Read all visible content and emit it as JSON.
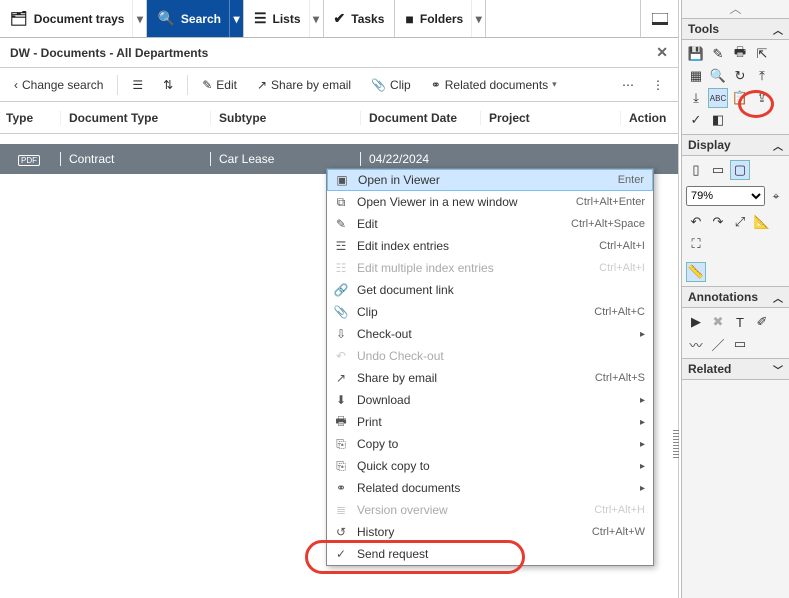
{
  "topTabs": {
    "trays": "Document trays",
    "search": "Search",
    "lists": "Lists",
    "tasks": "Tasks",
    "folders": "Folders"
  },
  "contextTitle": "DW - Documents - All Departments",
  "toolbar": {
    "changeSearch": "Change search",
    "edit": "Edit",
    "share": "Share by email",
    "clip": "Clip",
    "related": "Related documents"
  },
  "columns": {
    "type": "Type",
    "doctype": "Document Type",
    "subtype": "Subtype",
    "date": "Document Date",
    "project": "Project",
    "actions": "Action"
  },
  "row": {
    "badge": "PDF",
    "doctype": "Contract",
    "subtype": "Car Lease",
    "date": "04/22/2024"
  },
  "ctx": {
    "openViewer": "Open in Viewer",
    "openViewer_sc": "Enter",
    "openNew": "Open Viewer in a new window",
    "openNew_sc": "Ctrl+Alt+Enter",
    "edit": "Edit",
    "edit_sc": "Ctrl+Alt+Space",
    "editIdx": "Edit index entries",
    "editIdx_sc": "Ctrl+Alt+I",
    "editMulti": "Edit multiple index entries",
    "editMulti_sc": "Ctrl+Alt+I",
    "getLink": "Get document link",
    "clip": "Clip",
    "clip_sc": "Ctrl+Alt+C",
    "checkout": "Check-out",
    "undoCheckout": "Undo Check-out",
    "share": "Share by email",
    "share_sc": "Ctrl+Alt+S",
    "download": "Download",
    "print": "Print",
    "copyTo": "Copy to",
    "quickCopy": "Quick copy to",
    "related": "Related documents",
    "version": "Version overview",
    "version_sc": "Ctrl+Alt+H",
    "history": "History",
    "history_sc": "Ctrl+Alt+W",
    "sendReq": "Send request"
  },
  "side": {
    "tools": "Tools",
    "display": "Display",
    "zoom": "79%",
    "annotations": "Annotations",
    "related": "Related"
  }
}
